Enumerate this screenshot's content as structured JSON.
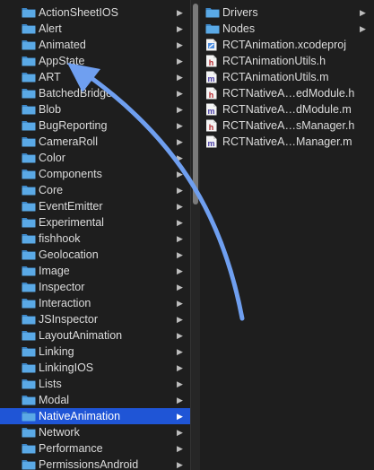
{
  "left_column": {
    "items": [
      {
        "label": "ActionSheetIOS",
        "icon": "folder-icon",
        "selected": false
      },
      {
        "label": "Alert",
        "icon": "folder-icon",
        "selected": false
      },
      {
        "label": "Animated",
        "icon": "folder-icon",
        "selected": false
      },
      {
        "label": "AppState",
        "icon": "folder-icon",
        "selected": false
      },
      {
        "label": "ART",
        "icon": "folder-icon",
        "selected": false
      },
      {
        "label": "BatchedBridge",
        "icon": "folder-icon",
        "selected": false
      },
      {
        "label": "Blob",
        "icon": "folder-icon",
        "selected": false
      },
      {
        "label": "BugReporting",
        "icon": "folder-icon",
        "selected": false
      },
      {
        "label": "CameraRoll",
        "icon": "folder-icon",
        "selected": false
      },
      {
        "label": "Color",
        "icon": "folder-icon",
        "selected": false
      },
      {
        "label": "Components",
        "icon": "folder-icon",
        "selected": false
      },
      {
        "label": "Core",
        "icon": "folder-icon",
        "selected": false
      },
      {
        "label": "EventEmitter",
        "icon": "folder-icon",
        "selected": false
      },
      {
        "label": "Experimental",
        "icon": "folder-icon",
        "selected": false
      },
      {
        "label": "fishhook",
        "icon": "folder-icon",
        "selected": false
      },
      {
        "label": "Geolocation",
        "icon": "folder-icon",
        "selected": false
      },
      {
        "label": "Image",
        "icon": "folder-icon",
        "selected": false
      },
      {
        "label": "Inspector",
        "icon": "folder-icon",
        "selected": false
      },
      {
        "label": "Interaction",
        "icon": "folder-icon",
        "selected": false
      },
      {
        "label": "JSInspector",
        "icon": "folder-icon",
        "selected": false
      },
      {
        "label": "LayoutAnimation",
        "icon": "folder-icon",
        "selected": false
      },
      {
        "label": "Linking",
        "icon": "folder-icon",
        "selected": false
      },
      {
        "label": "LinkingIOS",
        "icon": "folder-icon",
        "selected": false
      },
      {
        "label": "Lists",
        "icon": "folder-icon",
        "selected": false
      },
      {
        "label": "Modal",
        "icon": "folder-icon",
        "selected": false
      },
      {
        "label": "NativeAnimation",
        "icon": "folder-icon",
        "selected": true
      },
      {
        "label": "Network",
        "icon": "folder-icon",
        "selected": false
      },
      {
        "label": "Performance",
        "icon": "folder-icon",
        "selected": false
      },
      {
        "label": "PermissionsAndroid",
        "icon": "folder-icon",
        "selected": false
      }
    ]
  },
  "right_column": {
    "items": [
      {
        "label": "Drivers",
        "icon": "folder-icon",
        "kind": "folder"
      },
      {
        "label": "Nodes",
        "icon": "folder-icon",
        "kind": "folder"
      },
      {
        "label": "RCTAnimation.xcodeproj",
        "icon": "xcodeproj-file-icon",
        "kind": "xcodeproj",
        "letter": ""
      },
      {
        "label": "RCTAnimationUtils.h",
        "icon": "header-file-icon",
        "kind": "h",
        "letter": "h"
      },
      {
        "label": "RCTAnimationUtils.m",
        "icon": "objc-file-icon",
        "kind": "m",
        "letter": "m"
      },
      {
        "label": "RCTNativeA…edModule.h",
        "icon": "header-file-icon",
        "kind": "h",
        "letter": "h"
      },
      {
        "label": "RCTNativeA…dModule.m",
        "icon": "objc-file-icon",
        "kind": "m",
        "letter": "m"
      },
      {
        "label": "RCTNativeA…sManager.h",
        "icon": "header-file-icon",
        "kind": "h",
        "letter": "h"
      },
      {
        "label": "RCTNativeA…Manager.m",
        "icon": "objc-file-icon",
        "kind": "m",
        "letter": "m"
      }
    ]
  },
  "colors": {
    "background": "#1e1e1e",
    "selection": "#1f55d6",
    "folder": "#5aa9e6",
    "header_letter": "#b3262b",
    "objc_letter": "#4b3fa6",
    "arrow": "#6f9ff0"
  }
}
